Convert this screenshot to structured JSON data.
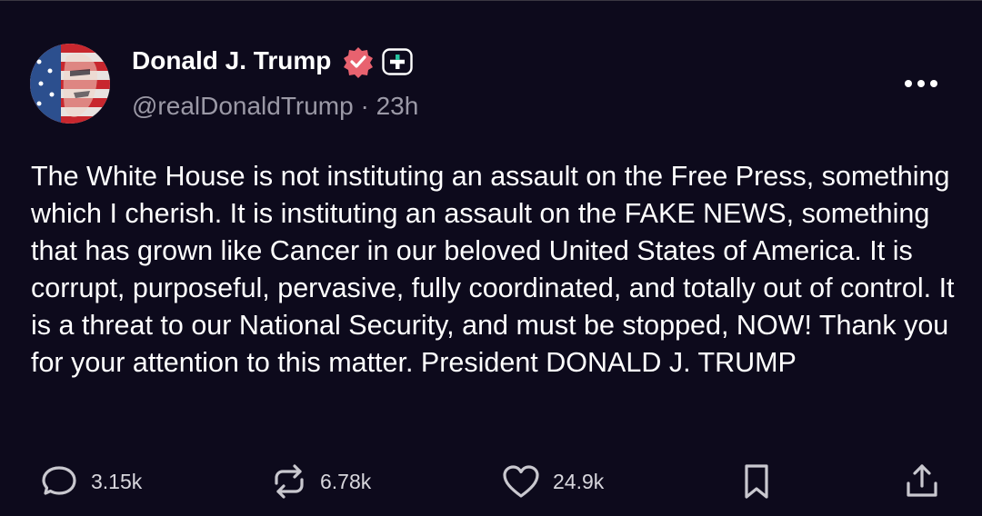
{
  "post": {
    "author": {
      "display_name": "Donald J. Trump",
      "handle": "@realDonaldTrump",
      "separator": "·",
      "time_ago": "23h",
      "avatar_icon": "avatar-image",
      "verified_icon": "verified-badge-icon",
      "plus_icon": "plus-badge-icon"
    },
    "text": "The White House is not instituting an assault on the Free Press, something which I cherish. It is instituting an assault on the FAKE NEWS, something that has grown like Cancer in our beloved United States of America. It is corrupt, purposeful, pervasive, fully coordinated, and totally out of control. It is a threat to our National Security, and must be stopped, NOW! Thank you for your attention to this matter. President DONALD J. TRUMP",
    "actions": {
      "replies": "3.15k",
      "reposts": "6.78k",
      "likes": "24.9k"
    }
  },
  "colors": {
    "background": "#0d0a1c",
    "text": "#ffffff",
    "secondary_text": "#9b99a6",
    "verified_badge": "#e8626f"
  }
}
